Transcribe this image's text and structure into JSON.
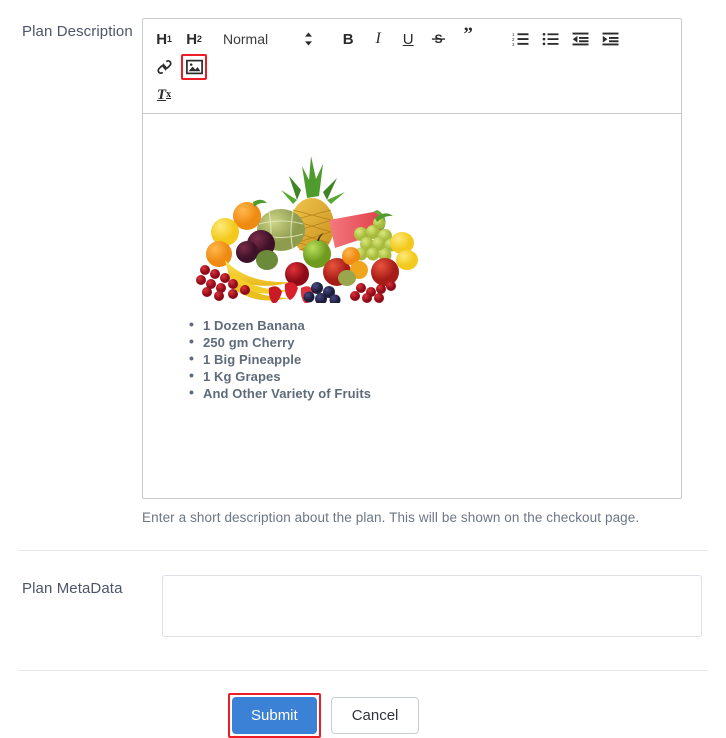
{
  "form": {
    "description_field": {
      "label": "Plan Description",
      "help_text": "Enter a short description about the plan. This will be shown on the checkout page."
    },
    "metadata_field": {
      "label": "Plan MetaData",
      "value": "",
      "placeholder": ""
    }
  },
  "editor": {
    "toolbar": {
      "h1_label": "H",
      "h1_sub": "1",
      "h2_label": "H",
      "h2_sub": "2",
      "format_select": "Normal",
      "bold_label": "B",
      "italic_label": "I",
      "underline_label": "U",
      "strike_label": "S",
      "blockquote_label": "”",
      "clear_format_label": "T",
      "clear_format_sub": "x",
      "ordered_list_name": "ordered-list",
      "bullet_list_name": "bullet-list",
      "outdent_name": "outdent",
      "indent_name": "indent",
      "link_name": "link",
      "image_name": "image"
    },
    "content": {
      "image_alt": "Assorted fresh fruits",
      "bullets": [
        "1 Dozen Banana",
        " 250 gm Cherry",
        "1 Big Pineapple",
        "1 Kg Grapes",
        "And Other Variety of Fruits"
      ]
    }
  },
  "buttons": {
    "submit_label": "Submit",
    "cancel_label": "Cancel"
  },
  "colors": {
    "submit_blue": "#3b82d6",
    "highlight_red": "#ee1c25",
    "border_gray": "#c8ccd0",
    "text_gray": "#5a6472"
  }
}
